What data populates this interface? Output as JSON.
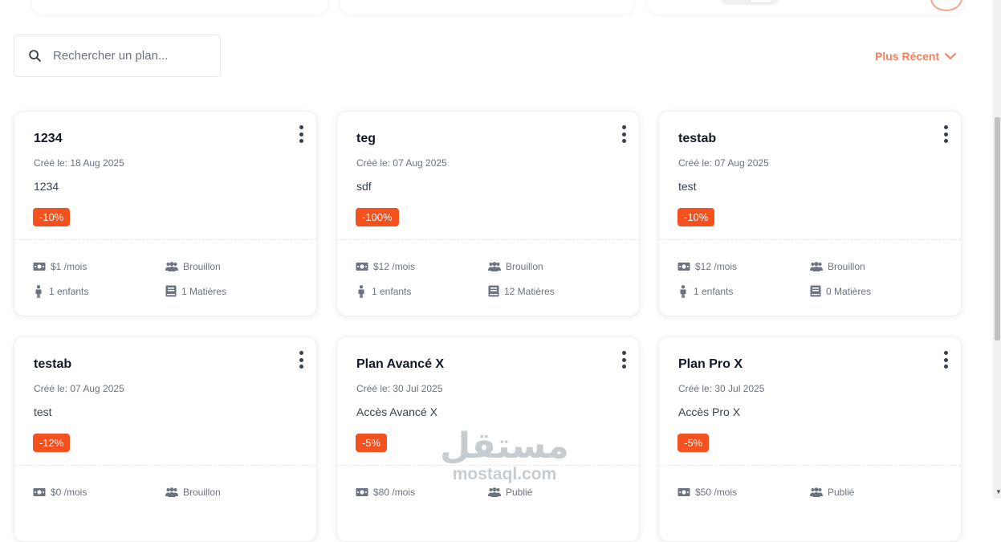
{
  "search": {
    "placeholder": "Rechercher un plan..."
  },
  "sort": {
    "label": "Plus Récent"
  },
  "plans": [
    {
      "name": "1234",
      "date": "Créé le: 18 Aug 2025",
      "description": "1234",
      "discount": "-10%",
      "price": "$1 /mois",
      "status": "Brouillon",
      "children": "1 enfants",
      "subjects": "1 Matières"
    },
    {
      "name": "teg",
      "date": "Créé le: 07 Aug 2025",
      "description": "sdf",
      "discount": "-100%",
      "price": "$12 /mois",
      "status": "Brouillon",
      "children": "1 enfants",
      "subjects": "12 Matières"
    },
    {
      "name": "testab",
      "date": "Créé le: 07 Aug 2025",
      "description": "test",
      "discount": "-10%",
      "price": "$12 /mois",
      "status": "Brouillon",
      "children": "1 enfants",
      "subjects": "0 Matières"
    },
    {
      "name": "testab",
      "date": "Créé le: 07 Aug 2025",
      "description": "test",
      "discount": "-12%",
      "price": "$0 /mois",
      "status": "Brouillon",
      "children": "",
      "subjects": ""
    },
    {
      "name": "Plan Avancé X",
      "date": "Créé le: 30 Jul 2025",
      "description": "Accès Avancé X",
      "discount": "-5%",
      "price": "$80 /mois",
      "status": "Publié",
      "children": "",
      "subjects": ""
    },
    {
      "name": "Plan Pro X",
      "date": "Créé le: 30 Jul 2025",
      "description": "Accès Pro X",
      "discount": "-5%",
      "price": "$50 /mois",
      "status": "Publié",
      "children": "",
      "subjects": ""
    }
  ],
  "watermark": {
    "arabic": "مستقل",
    "latin": "mostaql.com"
  },
  "colors": {
    "accent": "#f4815c",
    "badge": "#f4511e"
  }
}
